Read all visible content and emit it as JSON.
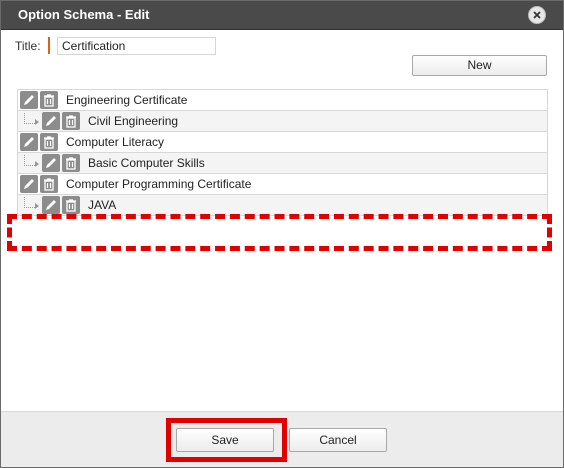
{
  "dialog": {
    "title": "Option Schema - Edit",
    "close_icon": "close-icon"
  },
  "form": {
    "title_label": "Title:",
    "title_value": "Certification",
    "new_button": "New"
  },
  "tree": {
    "rows": [
      {
        "label": "Engineering Certificate",
        "level": 0
      },
      {
        "label": "Civil Engineering",
        "level": 1
      },
      {
        "label": "Computer Literacy",
        "level": 0
      },
      {
        "label": "Basic Computer Skills",
        "level": 1
      },
      {
        "label": "Computer Programming Certificate",
        "level": 0
      },
      {
        "label": "JAVA",
        "level": 1
      }
    ],
    "row_icons": [
      "pencil-icon",
      "trash-icon"
    ]
  },
  "footer": {
    "save_button": "Save",
    "cancel_button": "Cancel"
  },
  "colors": {
    "titlebar": "#4a4a4a",
    "required_marker": "#e0601a",
    "annotation_red": "#e00000",
    "icon_bg": "#8c8c8c"
  }
}
